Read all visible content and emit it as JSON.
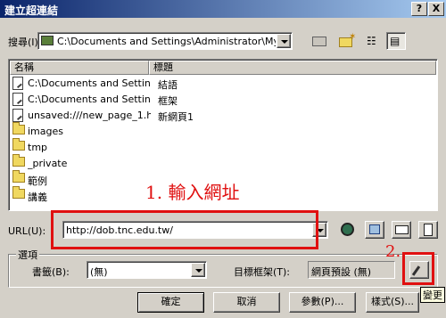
{
  "window": {
    "title": "建立超連結",
    "help_glyph": "?",
    "close_glyph": "X"
  },
  "lookin": {
    "label": "搜尋(I):",
    "value": "C:\\Documents and Settings\\Administrator\\My Docum"
  },
  "list": {
    "headers": [
      "名稱",
      "標題"
    ],
    "rows": [
      {
        "name": "C:\\Documents and Settin...",
        "type": "結語",
        "icon": "html-page-icon"
      },
      {
        "name": "C:\\Documents and Settin...",
        "type": "框架",
        "icon": "html-page-icon"
      },
      {
        "name": "unsaved:///new_page_1.h...",
        "type": "新網頁1",
        "icon": "html-page-icon"
      },
      {
        "name": "images",
        "type": "",
        "icon": "folder-icon"
      },
      {
        "name": "tmp",
        "type": "",
        "icon": "folder-icon"
      },
      {
        "name": "_private",
        "type": "",
        "icon": "folder-icon"
      },
      {
        "name": "範例",
        "type": "",
        "icon": "folder-icon"
      },
      {
        "name": "講義",
        "type": "",
        "icon": "folder-icon"
      }
    ]
  },
  "url": {
    "label": "URL(U):",
    "value": "http://dob.tnc.edu.tw/"
  },
  "options": {
    "legend": "選項",
    "bookmark_label": "書籤(B):",
    "bookmark_value": "(無)",
    "target_label": "目標框架(T):",
    "target_value": "網頁預設 (無)"
  },
  "buttons": {
    "ok": "確定",
    "cancel": "取消",
    "params": "參數(P)...",
    "style": "樣式(S)..."
  },
  "tooltip": "變更",
  "annotations": {
    "step1": "1. 輸入網址",
    "step2": "2."
  },
  "colors": {
    "title_start": "#0a246a",
    "title_end": "#a6caf0",
    "annotation": "#e01010",
    "face": "#d4d0c8"
  }
}
